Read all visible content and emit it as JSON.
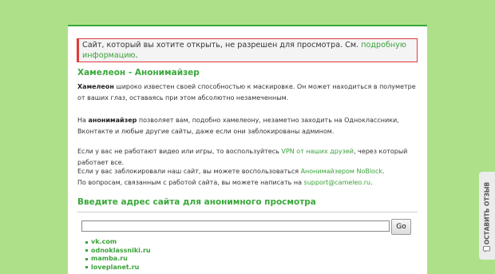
{
  "alert": {
    "text": "Сайт, который вы хотите открыть, не разрешен для просмотра. См.",
    "link": "подробную информацию",
    "end": "."
  },
  "section1": {
    "title": "Хамелеон - Анонимайзер",
    "p1_bold": "Хамелеон",
    "p1_text": " широко известен своей способностью к маскировке. Он может находиться в полуметре от ваших глаз, оставаясь при этом абсолютно незамеченным.",
    "p2_pre": "На ",
    "p2_bold": "анонимайзер",
    "p2_text": " позволяет вам, подобно хамелеону, незаметно заходить на Одноклассники, Вконтакте и любые другие сайты, даже если они заблокированы админом.",
    "p3_pre": "Если у вас не работают видео или игры, то воспользуйтесь ",
    "p3_link": "VPN от наших друзей",
    "p3_post": ", через который работает все.",
    "p4_pre": "Если у вас заблокировали наш сайт, вы можете воспользоваться ",
    "p4_link": "Анонимайзером NoBlock",
    "p4_post": ".",
    "p5_pre": "По вопросам, связанным с работой сайта, вы можете написать на ",
    "p5_link": "support@cameleo.ru",
    "p5_post": "."
  },
  "section2": {
    "title": "Введите адрес сайта для анонимного просмотра",
    "input_value": "",
    "go_label": "Go",
    "sites": [
      "vk.com",
      "odnoklassniki.ru",
      "mamba.ru",
      "loveplanet.ru"
    ]
  },
  "feedback": {
    "label": "ОСТАВИТЬ ОТЗЫВ",
    "icon": "feedback-icon"
  },
  "colors": {
    "background": "#aee08a",
    "accent": "#3aa83a",
    "alert_border": "#e03a3a"
  }
}
